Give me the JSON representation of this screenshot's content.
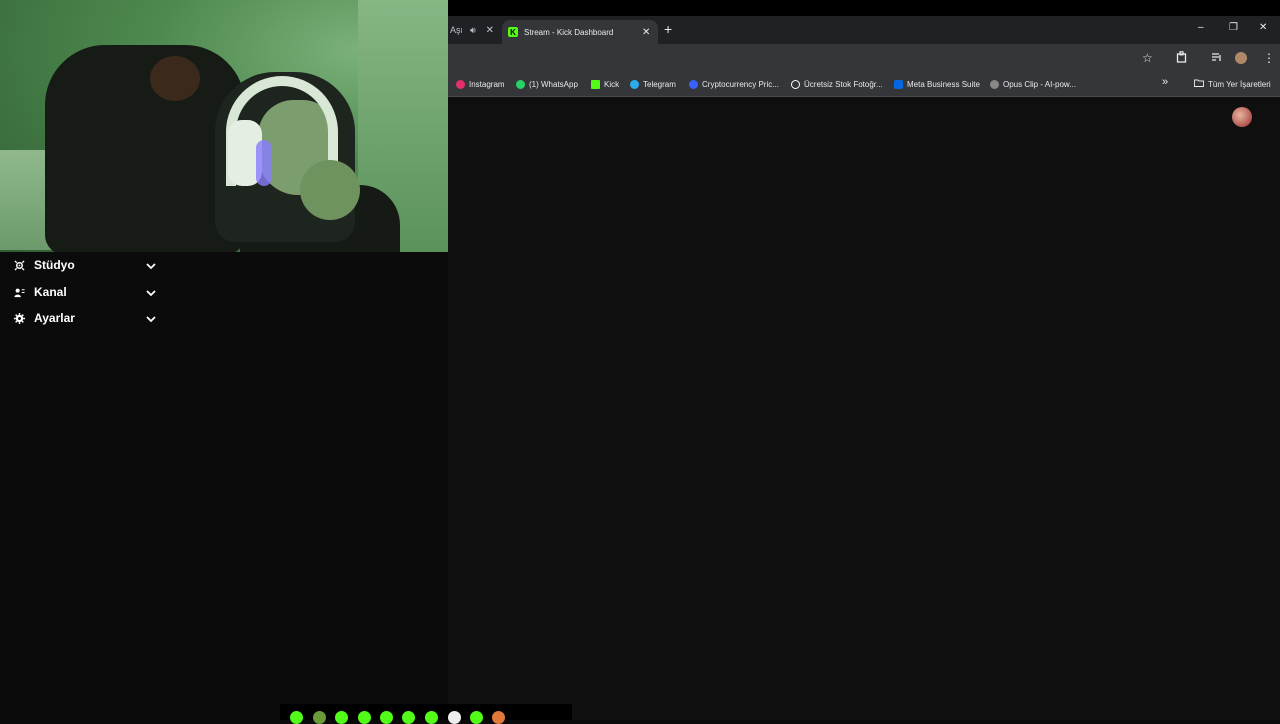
{
  "sidebar": {
    "items": [
      {
        "label": "Stüdyo",
        "icon": "studio-icon"
      },
      {
        "label": "Kanal",
        "icon": "channel-icon"
      },
      {
        "label": "Ayarlar",
        "icon": "gear-icon"
      }
    ]
  },
  "browser": {
    "prev_tab_label": "Aşı",
    "active_tab_label": "Stream - Kick Dashboard",
    "active_tab_favicon": "K",
    "new_tab_symbol": "+",
    "window_controls": {
      "minimize": "–",
      "restore": "❐",
      "close": "✕"
    },
    "bookmarks": [
      {
        "label": "Instagram",
        "color": "#e1306c"
      },
      {
        "label": "(1) WhatsApp",
        "color": "#25d366"
      },
      {
        "label": "Kick",
        "color": "#53fc18"
      },
      {
        "label": "Telegram",
        "color": "#2aabee"
      },
      {
        "label": "Cryptocurrency Pric...",
        "color": "#3861fb"
      },
      {
        "label": "Ücretsiz Stok Fotoğr...",
        "color": "#ffffff"
      },
      {
        "label": "Meta Business Suite",
        "color": "#0668e1"
      },
      {
        "label": "Opus Clip - AI-pow...",
        "color": "#888888"
      }
    ],
    "bookmarks_overflow": "»",
    "all_bookmarks_label": "Tüm Yer İşaretleri"
  },
  "colors": {
    "kick_green": "#53fc18",
    "tab_strip": "#202124",
    "toolbar": "#35363a",
    "page_bg": "#0f0f0f"
  }
}
